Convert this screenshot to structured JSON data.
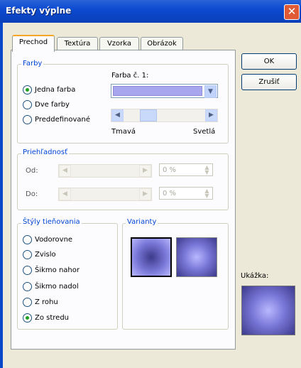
{
  "window": {
    "title": "Efekty výplne",
    "close_glyph": "✕"
  },
  "tabs": [
    {
      "label": "Prechod",
      "active": true
    },
    {
      "label": "Textúra",
      "active": false
    },
    {
      "label": "Vzorka",
      "active": false
    },
    {
      "label": "Obrázok",
      "active": false
    }
  ],
  "farby": {
    "group_label": "Farby",
    "radio_one": "Jedna farba",
    "radio_two": "Dve farby",
    "radio_preset": "Preddefinované",
    "color_label": "Farba č. 1:",
    "color_value": "#a9a6f0",
    "dark_label": "Tmavá",
    "light_label": "Svetlá",
    "selected": "Jedna farba"
  },
  "transparency": {
    "group_label": "Priehľadnosť",
    "from_label": "Od:",
    "to_label": "Do:",
    "from_value": "0 %",
    "to_value": "0 %"
  },
  "shading": {
    "group_label": "Štýly tieňovania",
    "styles": [
      "Vodorovne",
      "Zvislo",
      "Šikmo nahor",
      "Šikmo nadol",
      "Z rohu",
      "Zo stredu"
    ],
    "selected": "Zo stredu"
  },
  "variants": {
    "group_label": "Varianty"
  },
  "buttons": {
    "ok": "OK",
    "cancel": "Zrušiť"
  },
  "preview": {
    "label": "Ukážka:"
  },
  "colors": {
    "accent_blue": "#0046d5",
    "title_bar": "#0c4ad0",
    "fill": "#a9a6f0"
  }
}
